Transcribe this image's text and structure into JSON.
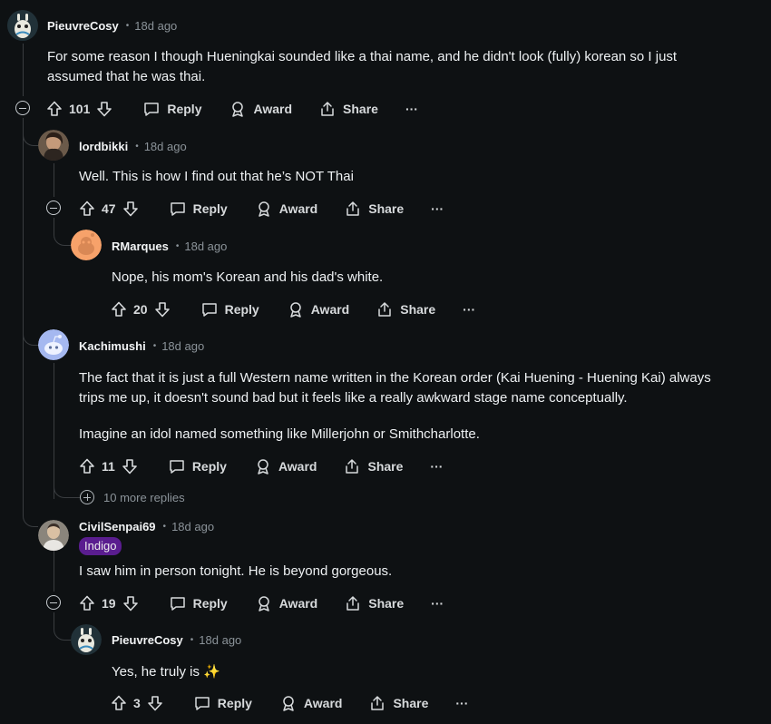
{
  "comments": [
    {
      "user": "PieuvreCosy",
      "time": "18d ago",
      "lines": [
        "For some reason I though Hueningkai sounded like a thai name, and he didn't look (fully) korean so I just",
        "assumed that he was thai."
      ],
      "score": "101"
    },
    {
      "user": "lordbikki",
      "time": "18d ago",
      "lines": [
        "Well. This is how I find out that he’s NOT Thai"
      ],
      "score": "47"
    },
    {
      "user": "RMarques",
      "time": "18d ago",
      "lines": [
        "Nope, his mom's Korean and his dad's white."
      ],
      "score": "20"
    },
    {
      "user": "Kachimushi",
      "time": "18d ago",
      "lines": [
        "The fact that it is just a full Western name written in the Korean order (Kai Huening - Huening Kai) always",
        "trips me up, it doesn't sound bad but it feels like a really awkward stage name conceptually.",
        "",
        "Imagine an idol named something like Millerjohn or Smithcharlotte."
      ],
      "score": "11"
    },
    {
      "user": "CivilSenpai69",
      "time": "18d ago",
      "flair": "Indigo",
      "lines": [
        "I saw him in person tonight. He is beyond gorgeous."
      ],
      "score": "19"
    },
    {
      "user": "PieuvreCosy",
      "time": "18d ago",
      "lines": [
        "Yes, he truly is ✨"
      ],
      "score": "3"
    }
  ],
  "actions": {
    "reply": "Reply",
    "award": "Award",
    "share": "Share",
    "more": "···"
  },
  "more_replies": "10 more replies",
  "separator": "•",
  "icons": [
    "upvote-icon",
    "downvote-icon",
    "reply-icon",
    "award-icon",
    "share-icon",
    "collapse-icon",
    "expand-icon"
  ],
  "colors": {
    "background": "#0e1113",
    "flair": "#5a1d8f",
    "text": "#eef1f3",
    "meta": "#8b9399"
  }
}
